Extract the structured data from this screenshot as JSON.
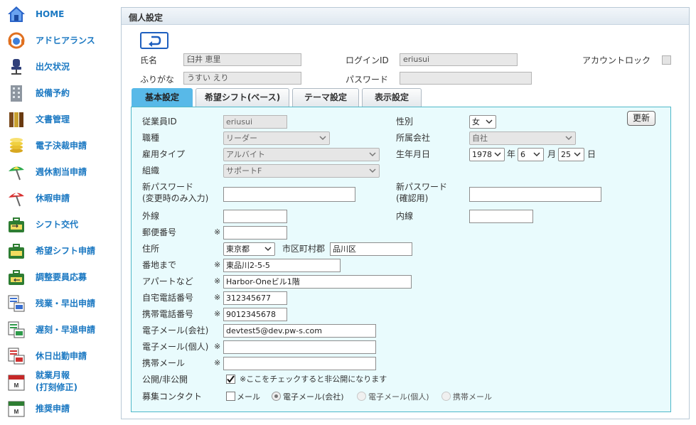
{
  "sidebar": {
    "items": [
      {
        "label": "HOME",
        "icon": "home-icon"
      },
      {
        "label": "アドヒアランス",
        "icon": "headset-icon"
      },
      {
        "label": "出欠状況",
        "icon": "chair-icon"
      },
      {
        "label": "設備予約",
        "icon": "building-icon"
      },
      {
        "label": "文書管理",
        "icon": "binders-icon"
      },
      {
        "label": "電子決裁申請",
        "icon": "coins-icon"
      },
      {
        "label": "週休割当申請",
        "icon": "parasol-icon"
      },
      {
        "label": "休暇申請",
        "icon": "parasol-red-icon"
      },
      {
        "label": "シフト交代",
        "icon": "toolbox-swap-icon"
      },
      {
        "label": "希望シフト申請",
        "icon": "toolbox-icon"
      },
      {
        "label": "調整要員応募",
        "icon": "toolbox-arrow-icon"
      },
      {
        "label": "残業・早出申請",
        "icon": "timesheet-icon"
      },
      {
        "label": "遅刻・早退申請",
        "icon": "timesheet-green-icon"
      },
      {
        "label": "休日出勤申請",
        "icon": "timesheet-red-icon"
      },
      {
        "label_line1": "就業月報",
        "label_line2": "(打刻修正)",
        "icon": "month-calendar-icon"
      },
      {
        "label": "推奨申請",
        "icon": "month-calendar-green-icon"
      }
    ]
  },
  "panel": {
    "title": "個人設定",
    "name_label": "氏名",
    "name_value": "臼井 恵里",
    "kana_label": "ふりがな",
    "kana_value": "うすい えり",
    "login_label": "ログインID",
    "login_value": "eriusui",
    "password_label": "パスワード",
    "password_value": "",
    "lock_label": "アカウントロック"
  },
  "tabs": [
    "基本設定",
    "希望シフト(ベース)",
    "テーマ設定",
    "表示設定"
  ],
  "form": {
    "update_label": "更新",
    "employee_id_label": "従業員ID",
    "employee_id_value": "eriusui",
    "job_label": "職種",
    "job_value": "リーダー",
    "employment_label": "雇用タイプ",
    "employment_value": "アルバイト",
    "org_label": "組織",
    "org_value": "サポートF",
    "gender_label": "性別",
    "gender_value": "女",
    "company_label": "所属会社",
    "company_value": "自社",
    "birth_label": "生年月日",
    "birth_year": "1978",
    "birth_month": "6",
    "birth_day": "25",
    "year_unit": "年",
    "month_unit": "月",
    "day_unit": "日",
    "newpw_label_1": "新パスワード",
    "newpw_label_2": "(変更時のみ入力)",
    "newpw_confirm_label_1": "新パスワード",
    "newpw_confirm_label_2": "(確認用)",
    "outside_label": "外線",
    "inside_label": "内線",
    "postal_label": "郵便番号",
    "address_label": "住所",
    "prefecture_value": "東京都",
    "city_label": "市区町村郡",
    "city_value": "品川区",
    "street_label": "番地まで",
    "street_value": "東品川2-5-5",
    "building_label": "アパートなど",
    "building_value": "Harbor-Oneビル1階",
    "home_phone_label": "自宅電話番号",
    "home_phone_value": "312345677",
    "mobile_label": "携帯電話番号",
    "mobile_value": "9012345678",
    "email_company_label": "電子メール(会社)",
    "email_company_value": "devtest5@dev.pw-s.com",
    "email_personal_label": "電子メール(個人)",
    "mobile_mail_label": "携帯メール",
    "public_label": "公開/非公開",
    "public_note": "※ここをチェックすると非公開になります",
    "contact_label": "募集コンタクト",
    "contact_mail": "メール",
    "contact_company": "電子メール(会社)",
    "contact_personal": "電子メール(個人)",
    "contact_mobile": "携帯メール",
    "req_mark": "※"
  }
}
